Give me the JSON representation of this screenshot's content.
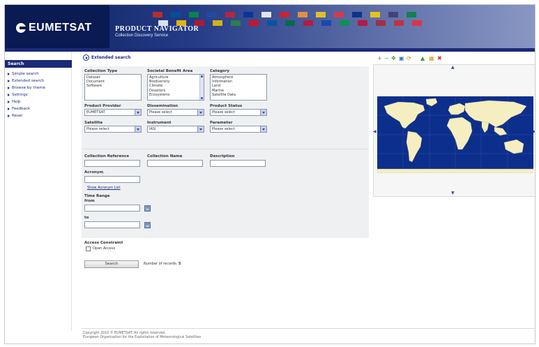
{
  "header": {
    "logo_text": "EUMETSAT",
    "title": "PRODUCT NAVIGATOR",
    "subtitle": "Collection Discovery Service",
    "flag_colors": [
      "#d52b1e",
      "#ffffff",
      "#00529b",
      "#ffcd00",
      "#009246",
      "#ce1126",
      "#1f4fa3",
      "#f1c400",
      "#d0202f",
      "#2d8a3f",
      "#003399",
      "#e30a17",
      "#ffffff",
      "#0055a4",
      "#e31b23",
      "#006b3f",
      "#ff9933",
      "#c8102e",
      "#fcd116",
      "#0f47af",
      "#ef3340",
      "#009a44",
      "#002b7f",
      "#cc092f",
      "#ffd100",
      "#b22234",
      "#3c3b6e",
      "#d22630",
      "#00843d",
      "#ed2939"
    ]
  },
  "sidebar": {
    "heading": "Search",
    "items": [
      {
        "label": "Simple search"
      },
      {
        "label": "Extended search"
      },
      {
        "label": "Browse by theme"
      },
      {
        "label": "Settings"
      },
      {
        "label": "Help"
      },
      {
        "label": "Feedback"
      },
      {
        "label": "Reset"
      }
    ]
  },
  "main": {
    "heading": "Extended search",
    "collection_type": {
      "label": "Collection Type",
      "options": [
        "Dataset",
        "Document",
        "Software"
      ]
    },
    "societal_benefit": {
      "label": "Societal Benefit Area",
      "options": [
        "Agriculture",
        "Biodiversity",
        "Climate",
        "Disasters",
        "Ecosystems"
      ]
    },
    "category": {
      "label": "Category",
      "options": [
        "Atmosphere",
        "Information",
        "Land",
        "Marine",
        "Satellite Data"
      ]
    },
    "product_provider": {
      "label": "Product Provider",
      "value": "EUMETSAT"
    },
    "dissemination": {
      "label": "Dissemination",
      "value": "Please select"
    },
    "product_status": {
      "label": "Product Status",
      "value": "Please select"
    },
    "satellite": {
      "label": "Satellite",
      "value": "Please select"
    },
    "instrument": {
      "label": "Instrument",
      "value": "IASI"
    },
    "parameter": {
      "label": "Parameter",
      "value": "Please select"
    },
    "collection_reference": {
      "label": "Collection Reference"
    },
    "collection_name": {
      "label": "Collection Name"
    },
    "description": {
      "label": "Description"
    },
    "acronym": {
      "label": "Acronym",
      "link": "Show Acronym List"
    },
    "time_range": {
      "label": "Time Range",
      "from_label": "from",
      "to_label": "to"
    },
    "access_constraint": {
      "label": "Access Constraint",
      "option": "Open Access"
    },
    "search_button": "Search",
    "records_label": "Number of records:",
    "records_value": "5"
  },
  "footer": {
    "line1": "Copyright 2010 © EUMETSAT. All rights reserved.",
    "line2": "European Organisation for the Exploitation of Meteorological Satellites"
  },
  "map": {
    "tools": [
      "zoom-in-icon",
      "zoom-out-icon",
      "pan-icon",
      "full-extent-icon",
      "refresh-icon",
      "select-icon",
      "bbox-icon",
      "clear-icon"
    ],
    "ocean_color": "#0d2f8c",
    "land_color": "#f5eec0"
  }
}
